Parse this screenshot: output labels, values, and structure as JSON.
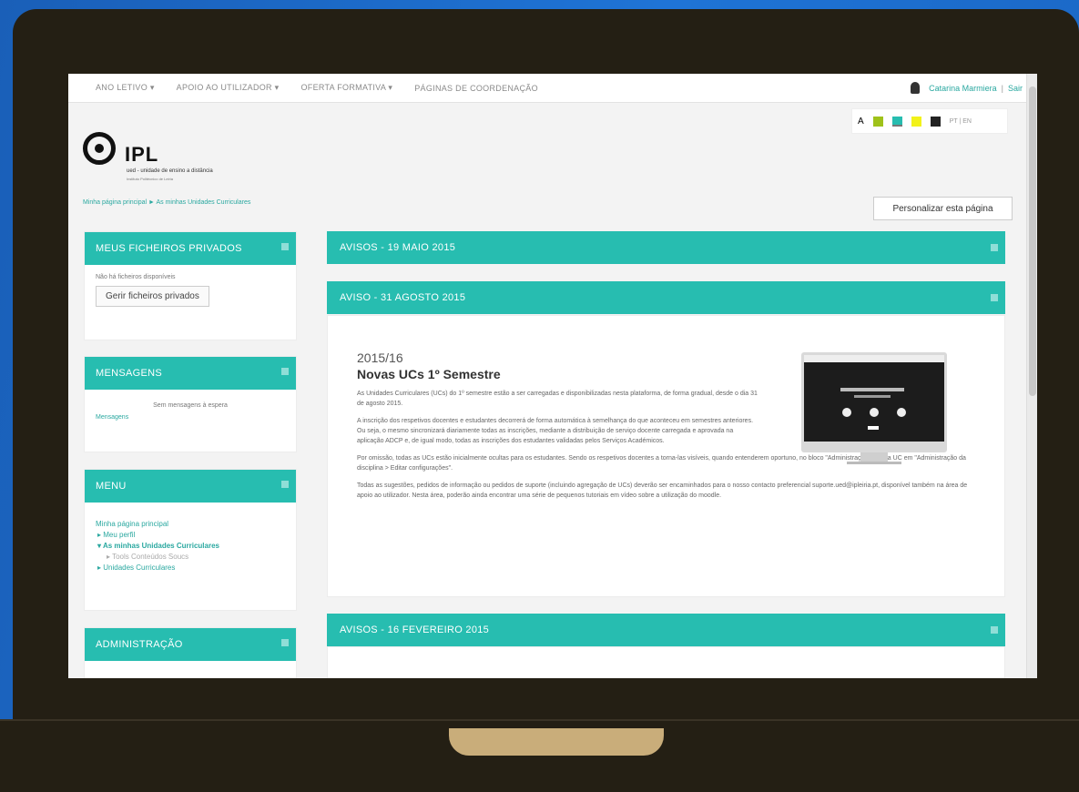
{
  "nav": {
    "items": [
      "ANO LETIVO ▾",
      "APOIO AO UTILIZADOR ▾",
      "OFERTA FORMATIVA ▾",
      "PÁGINAS DE COORDENAÇÃO"
    ],
    "user_name": "Catarina Marmiera",
    "separator": "|",
    "logout": "Sair"
  },
  "access": {
    "font_label": "A",
    "swatches": [
      "#9fc21a",
      "#27bdb0",
      "#f2f21a",
      "#222222"
    ],
    "lang": "PT | EN"
  },
  "logo": {
    "name": "IPL",
    "subtitle": "ued - unidade de ensino a distância",
    "tagline": "Instituto Politécnico de Leiria"
  },
  "breadcrumb": "Minha página principal  ►  As minhas Unidades Curriculares",
  "customize_button": "Personalizar esta página",
  "blocks": {
    "files": {
      "title": "MEUS FICHEIROS PRIVADOS",
      "empty": "Não há ficheiros disponíveis",
      "button": "Gerir ficheiros privados"
    },
    "messages": {
      "title": "MENSAGENS",
      "empty": "Sem mensagens à espera",
      "link": "Mensagens"
    },
    "menu": {
      "title": "MENU",
      "items": [
        "Minha página principal",
        "▸ Meu perfil",
        "▾ As minhas Unidades Curriculares",
        "▸ Tools Conteúdos Soucs",
        "▸ Unidades Curriculares"
      ]
    },
    "admin": {
      "title": "ADMINISTRAÇÃO"
    }
  },
  "main": {
    "h1": "AVISOS - 19 MAIO 2015",
    "h2": "AVISO - 31 AGOSTO 2015",
    "h3": "AVISOS - 16 FEVEREIRO 2015",
    "year": "2015/16",
    "title": "Novas UCs 1º Semestre",
    "p1": "As Unidades Curriculares (UCs) do 1º semestre estão a ser carregadas e disponibilizadas nesta plataforma, de forma gradual, desde o dia 31 de agosto 2015.",
    "p2": "A inscrição dos respetivos docentes e estudantes decorrerá de forma automática à semelhança do que aconteceu em semestres anteriores. Ou seja, o mesmo sincronizará diariamente todas as inscrições, mediante a distribuição de serviço docente carregada e aprovada na aplicação ADCP e, de igual modo, todas as inscrições dos estudantes validadas pelos Serviços Académicos.",
    "p3": "Por omissão, todas as UCs estão inicialmente ocultas para os estudantes. Sendo os respetivos docentes a torna-las visíveis, quando entenderem oportuno, no bloco \"Administração\" da sua UC em \"Administração da disciplina > Editar configurações\".",
    "p4": "Todas as sugestões, pedidos de informação ou pedidos de suporte (incluindo agregação de UCs) deverão ser encaminhados para o nosso contacto preferencial suporte.ued@ipleiria.pt, disponível também na área de apoio ao utilizador. Nesta área, poderão ainda encontrar uma série de pequenos tutoriais em vídeo sobre a utilização do moodle."
  }
}
